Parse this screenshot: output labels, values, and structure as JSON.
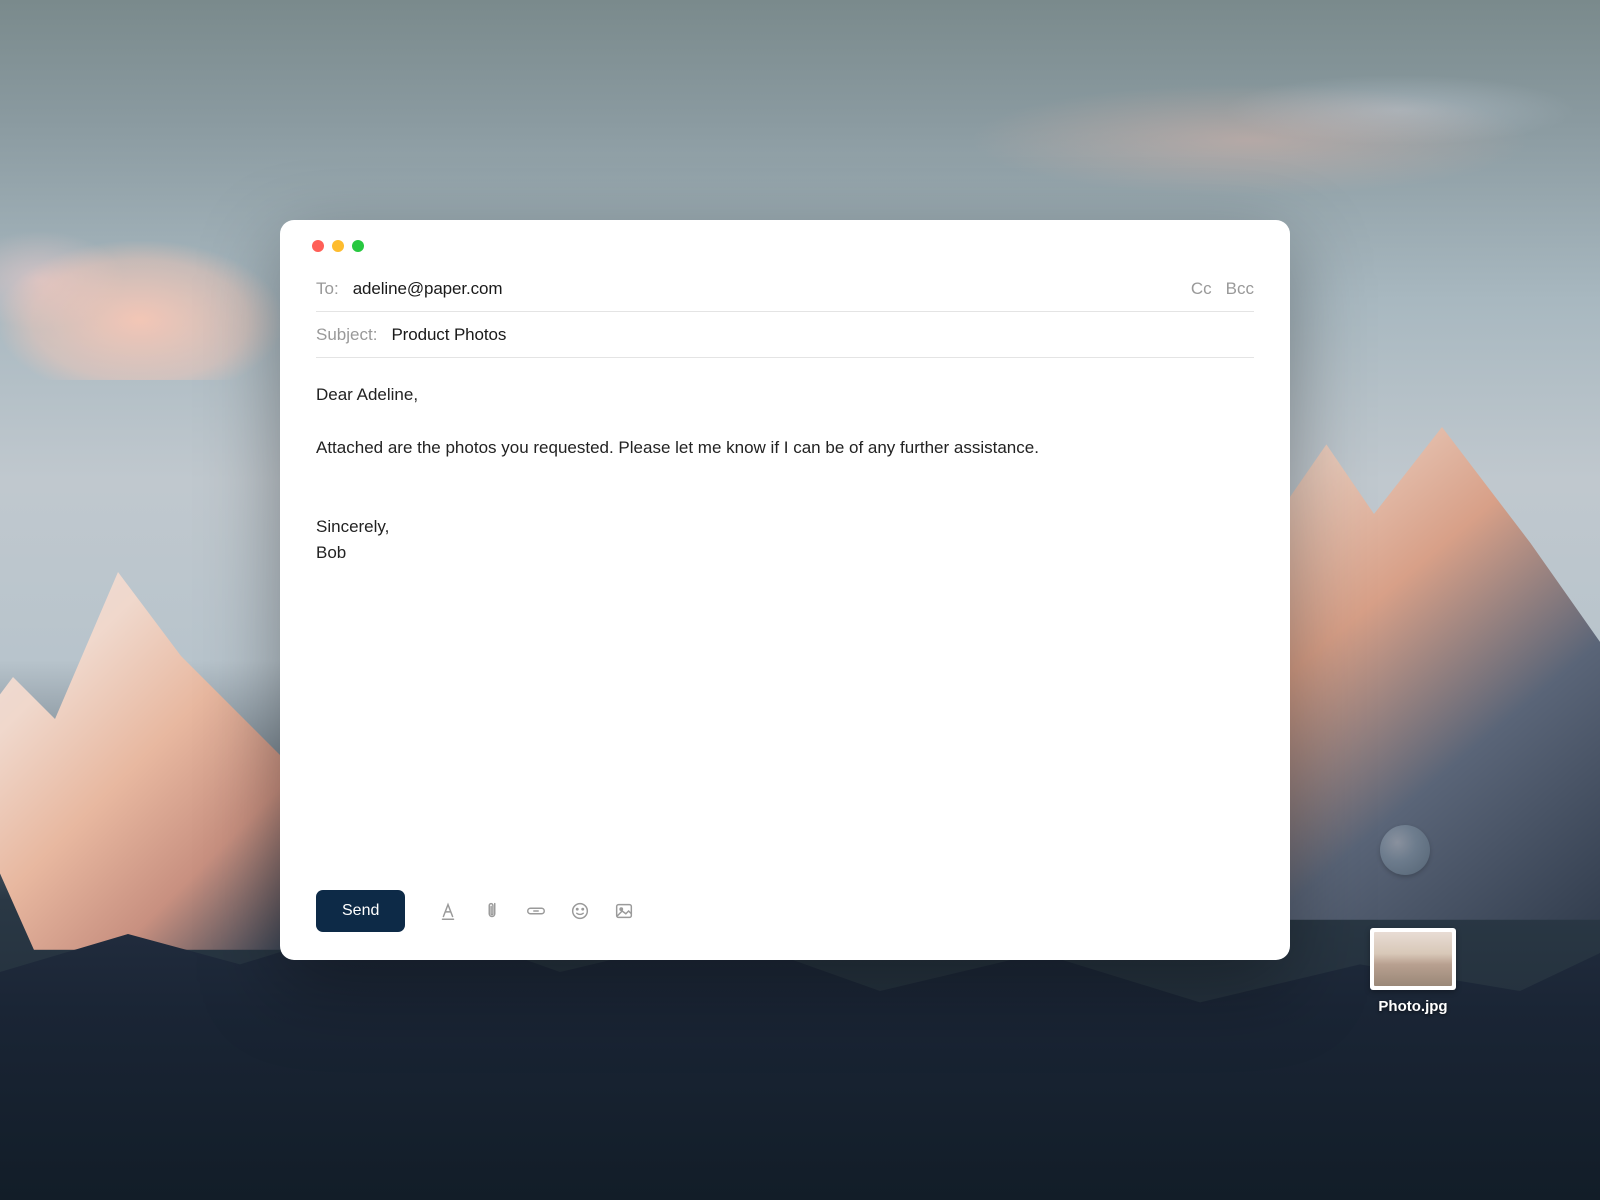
{
  "compose": {
    "to_label": "To:",
    "to_value": "adeline@paper.com",
    "cc_label": "Cc",
    "bcc_label": "Bcc",
    "subject_label": "Subject:",
    "subject_value": "Product Photos",
    "body": "Dear Adeline,\n\nAttached are the photos you requested. Please let me know if I can be of any further assistance.\n\n\nSincerely,\nBob",
    "send_label": "Send"
  },
  "desktop": {
    "file_name": "Photo.jpg"
  }
}
